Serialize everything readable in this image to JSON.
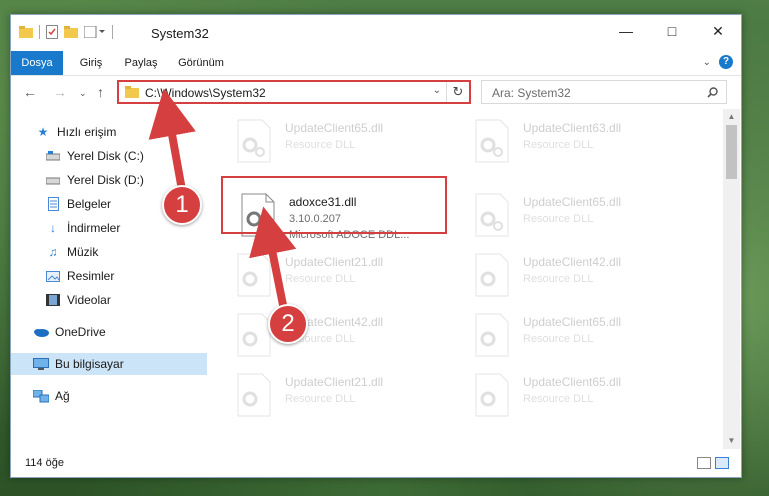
{
  "window": {
    "title": "System32",
    "controls": [
      "minimize-icon",
      "maximize-icon",
      "close-icon"
    ]
  },
  "ribbon": {
    "tabs": [
      "Dosya",
      "Giriş",
      "Paylaş",
      "Görünüm"
    ],
    "help": "?"
  },
  "nav": {
    "address": "C:\\Windows\\System32",
    "search_placeholder": "Ara: System32"
  },
  "sidebar": {
    "quick_access": "Hızlı erişim",
    "items": [
      {
        "label": "Yerel Disk (C:)",
        "icon": "drive-icon"
      },
      {
        "label": "Yerel Disk (D:)",
        "icon": "drive-icon"
      },
      {
        "label": "Belgeler",
        "icon": "documents-icon"
      },
      {
        "label": "İndirmeler",
        "icon": "download-icon"
      },
      {
        "label": "Müzik",
        "icon": "music-icon"
      },
      {
        "label": "Resimler",
        "icon": "pictures-icon"
      },
      {
        "label": "Videolar",
        "icon": "videos-icon"
      }
    ],
    "onedrive": "OneDrive",
    "this_pc": "Bu bilgisayar",
    "network": "Ağ"
  },
  "files": {
    "selected": {
      "name": "adoxce31.dll",
      "version": "3.10.0.207",
      "desc": "Microsoft ADOCE DDL..."
    },
    "grid": [
      {
        "name": "UpdateClient65.dll",
        "desc": "Resource DLL"
      },
      {
        "name": "UpdateClient63.dll",
        "desc": "Resource DLL"
      },
      {
        "name": "UpdateClient65.dll",
        "desc": "Resource DLL"
      },
      {
        "name": "UpdateClient21.dll",
        "desc": "Resource DLL"
      },
      {
        "name": "UpdateClient42.dll",
        "desc": "Resource DLL"
      },
      {
        "name": "UpdateClient42.dll",
        "desc": "Resource DLL"
      },
      {
        "name": "UpdateClient65.dll",
        "desc": "Resource DLL"
      },
      {
        "name": "UpdateClient21.dll",
        "desc": "Resource DLL"
      },
      {
        "name": "UpdateClient65.dll",
        "desc": "Resource DLL"
      }
    ]
  },
  "status": {
    "count": "114 öğe"
  },
  "annotations": {
    "step1": "1",
    "step2": "2",
    "color": "#d63f3f"
  }
}
